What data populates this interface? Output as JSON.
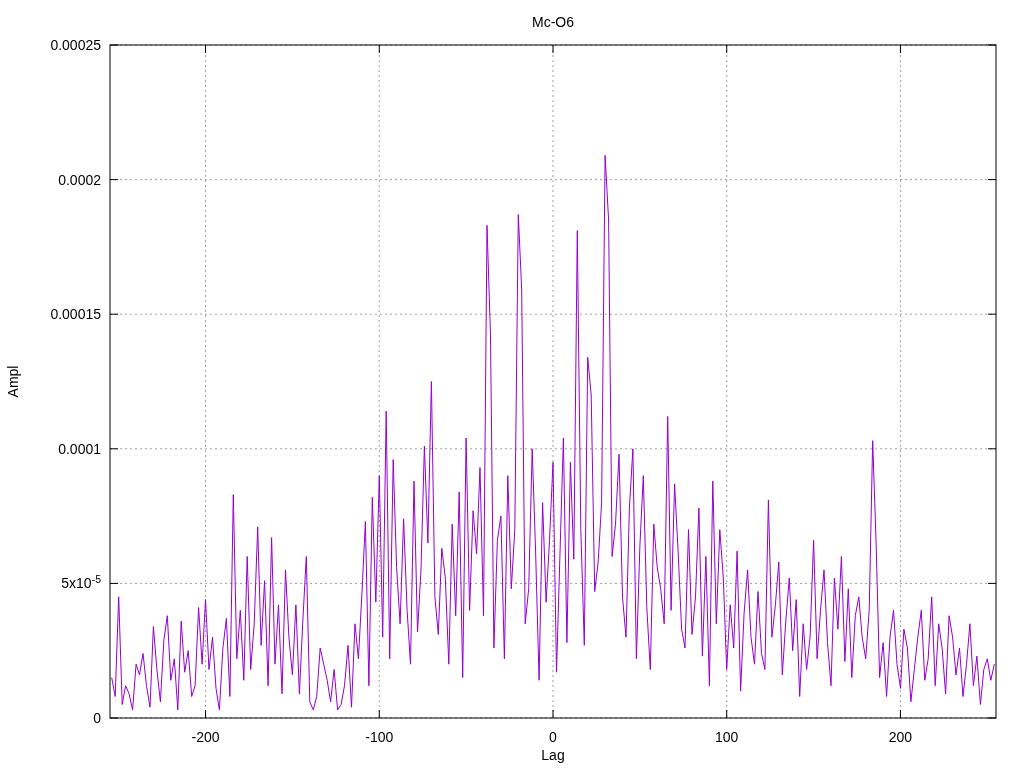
{
  "chart_data": {
    "type": "line",
    "title": "Mc-O6",
    "xlabel": "Lag",
    "ylabel": "Ampl",
    "xlim": [
      -255,
      255
    ],
    "ylim": [
      0,
      0.00025
    ],
    "grid": true,
    "xticks": [
      -200,
      -100,
      0,
      100,
      200
    ],
    "yticks": [
      {
        "value": 0,
        "label": "0"
      },
      {
        "value": 5e-05,
        "label": "5x10$^{-5}$"
      },
      {
        "value": 0.0001,
        "label": "0.0001"
      },
      {
        "value": 0.00015,
        "label": "0.00015"
      },
      {
        "value": 0.0002,
        "label": "0.0002"
      },
      {
        "value": 0.00025,
        "label": "0.00025"
      }
    ],
    "x": [
      -254,
      -252,
      -250,
      -248,
      -246,
      -244,
      -242,
      -240,
      -238,
      -236,
      -234,
      -232,
      -230,
      -228,
      -226,
      -224,
      -222,
      -220,
      -218,
      -216,
      -214,
      -212,
      -210,
      -208,
      -206,
      -204,
      -202,
      -200,
      -198,
      -196,
      -194,
      -192,
      -190,
      -188,
      -186,
      -184,
      -182,
      -180,
      -178,
      -176,
      -174,
      -172,
      -170,
      -168,
      -166,
      -164,
      -162,
      -160,
      -158,
      -156,
      -154,
      -152,
      -150,
      -148,
      -146,
      -144,
      -142,
      -140,
      -138,
      -136,
      -134,
      -132,
      -130,
      -128,
      -126,
      -124,
      -122,
      -120,
      -118,
      -116,
      -114,
      -112,
      -110,
      -108,
      -106,
      -104,
      -102,
      -100,
      -98,
      -96,
      -94,
      -92,
      -90,
      -88,
      -86,
      -84,
      -82,
      -80,
      -78,
      -76,
      -74,
      -72,
      -70,
      -68,
      -66,
      -64,
      -62,
      -60,
      -58,
      -56,
      -54,
      -52,
      -50,
      -48,
      -46,
      -44,
      -42,
      -40,
      -38,
      -36,
      -34,
      -32,
      -30,
      -28,
      -26,
      -24,
      -22,
      -20,
      -18,
      -16,
      -14,
      -12,
      -10,
      -8,
      -6,
      -4,
      -2,
      0,
      2,
      4,
      6,
      8,
      10,
      12,
      14,
      16,
      18,
      20,
      22,
      24,
      26,
      28,
      30,
      32,
      34,
      36,
      38,
      40,
      42,
      44,
      46,
      48,
      50,
      52,
      54,
      56,
      58,
      60,
      62,
      64,
      66,
      68,
      70,
      72,
      74,
      76,
      78,
      80,
      82,
      84,
      86,
      88,
      90,
      92,
      94,
      96,
      98,
      100,
      102,
      104,
      106,
      108,
      110,
      112,
      114,
      116,
      118,
      120,
      122,
      124,
      126,
      128,
      130,
      132,
      134,
      136,
      138,
      140,
      142,
      144,
      146,
      148,
      150,
      152,
      154,
      156,
      158,
      160,
      162,
      164,
      166,
      168,
      170,
      172,
      174,
      176,
      178,
      180,
      182,
      184,
      186,
      188,
      190,
      192,
      194,
      196,
      198,
      200,
      202,
      204,
      206,
      208,
      210,
      212,
      214,
      216,
      218,
      220,
      222,
      224,
      226,
      228,
      230,
      232,
      234,
      236,
      238,
      240,
      242,
      244,
      246,
      248,
      250,
      252,
      254
    ],
    "series": [
      {
        "color": "#9400d3",
        "values": [
          1.5e-05,
          8e-06,
          4.5e-05,
          5e-06,
          1.2e-05,
          9e-06,
          3e-06,
          2e-05,
          1.6e-05,
          2.4e-05,
          1.2e-05,
          4e-06,
          3.4e-05,
          1.8e-05,
          6e-06,
          2.9e-05,
          3.8e-05,
          1.4e-05,
          2.2e-05,
          3e-06,
          3.6e-05,
          1.7e-05,
          2.5e-05,
          8e-06,
          1.2e-05,
          4.1e-05,
          2e-05,
          4.4e-05,
          1.8e-05,
          3e-05,
          1.1e-05,
          3e-06,
          2.6e-05,
          3.7e-05,
          8e-06,
          8.3e-05,
          2.2e-05,
          4e-05,
          1.4e-05,
          6e-05,
          1.8e-05,
          3.5e-05,
          7.1e-05,
          2.7e-05,
          5.1e-05,
          1.2e-05,
          6.7e-05,
          2e-05,
          4.2e-05,
          9e-06,
          5.5e-05,
          3e-05,
          1.6e-05,
          4.2e-05,
          9e-06,
          3.6e-05,
          6e-05,
          6e-06,
          3e-06,
          8e-06,
          2.6e-05,
          2e-05,
          1.4e-05,
          6e-06,
          1.8e-05,
          3e-06,
          5e-06,
          1.2e-05,
          2.7e-05,
          4e-06,
          3.5e-05,
          2.2e-05,
          4.6e-05,
          7.3e-05,
          1.2e-05,
          8.2e-05,
          4.3e-05,
          9e-05,
          3e-05,
          0.000114,
          2.2e-05,
          9.6e-05,
          5.6e-05,
          3.5e-05,
          7.4e-05,
          4e-05,
          2e-05,
          8.8e-05,
          3.2e-05,
          5.5e-05,
          0.000101,
          6.5e-05,
          0.000125,
          4.5e-05,
          3.1e-05,
          6.3e-05,
          5.2e-05,
          2e-05,
          7.2e-05,
          3.8e-05,
          8.4e-05,
          1.5e-05,
          0.000104,
          4e-05,
          7.7e-05,
          6.1e-05,
          9.3e-05,
          3.8e-05,
          0.000183,
          0.000142,
          2.6e-05,
          6.6e-05,
          7.5e-05,
          2.2e-05,
          9e-05,
          4.8e-05,
          7e-05,
          0.000187,
          0.000159,
          3.5e-05,
          4.8e-05,
          0.0001,
          6.2e-05,
          1.4e-05,
          8e-05,
          4.3e-05,
          6.6e-05,
          9.5e-05,
          1.7e-05,
          6e-05,
          0.000104,
          2.8e-05,
          9.5e-05,
          5.9e-05,
          0.000181,
          7e-05,
          2.7e-05,
          0.000134,
          0.00012,
          4.7e-05,
          5.8e-05,
          8e-05,
          0.000209,
          0.000185,
          6e-05,
          7.2e-05,
          9.8e-05,
          4.5e-05,
          3e-05,
          7.8e-05,
          0.0001,
          2.2e-05,
          6.4e-05,
          9e-05,
          4.1e-05,
          1.8e-05,
          7.2e-05,
          5.6e-05,
          4.8e-05,
          3.5e-05,
          0.000112,
          4e-05,
          8.7e-05,
          6.2e-05,
          3.3e-05,
          2.6e-05,
          7e-05,
          3.1e-05,
          4.5e-05,
          7.8e-05,
          2.3e-05,
          6e-05,
          1.2e-05,
          8.8e-05,
          3.5e-05,
          7e-05,
          5.2e-05,
          1.8e-05,
          4.2e-05,
          2.6e-05,
          6.2e-05,
          1e-05,
          3.9e-05,
          5.5e-05,
          3e-05,
          2e-05,
          4.7e-05,
          2.4e-05,
          1.8e-05,
          8.1e-05,
          3e-05,
          4.2e-05,
          5.8e-05,
          1.6e-05,
          3.6e-05,
          5.2e-05,
          2.5e-05,
          4.4e-05,
          8e-06,
          3.5e-05,
          1.8e-05,
          3e-05,
          6.6e-05,
          2.2e-05,
          4e-05,
          5.5e-05,
          2.8e-05,
          1.2e-05,
          5.2e-05,
          3.3e-05,
          6e-05,
          2.1e-05,
          4.8e-05,
          1.5e-05,
          3.8e-05,
          4.5e-05,
          3e-05,
          2.2e-05,
          4e-05,
          0.000103,
          6.5e-05,
          1.5e-05,
          2.8e-05,
          8e-06,
          3e-05,
          4e-05,
          2e-05,
          1.1e-05,
          3.3e-05,
          2.6e-05,
          6e-06,
          1.8e-05,
          3e-05,
          4e-05,
          1.4e-05,
          2.2e-05,
          4.5e-05,
          1.2e-05,
          3.5e-05,
          2.6e-05,
          9e-06,
          3.8e-05,
          3e-05,
          1.6e-05,
          2.6e-05,
          8e-06,
          2e-05,
          3.5e-05,
          1.2e-05,
          2.3e-05,
          5e-06,
          1.8e-05,
          2.2e-05,
          1.4e-05,
          2e-05
        ]
      }
    ]
  }
}
